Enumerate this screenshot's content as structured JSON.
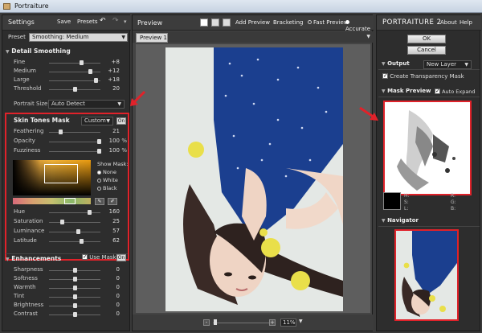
{
  "window": {
    "title": "Portraiture"
  },
  "left": {
    "settings_label": "Settings",
    "save_label": "Save",
    "presets_label": "Presets",
    "preset_label": "Preset",
    "preset_value": "Smoothing: Medium",
    "detail_smoothing_title": "Detail Smoothing",
    "detail_rows": [
      {
        "label": "Fine",
        "value": "+8",
        "pos": 0.62
      },
      {
        "label": "Medium",
        "value": "+12",
        "pos": 0.8
      },
      {
        "label": "Large",
        "value": "+18",
        "pos": 0.9
      },
      {
        "label": "Threshold",
        "value": "20",
        "pos": 0.5
      }
    ],
    "portrait_size_label": "Portrait Size",
    "portrait_size_value": "Auto Detect",
    "skin_title": "Skin Tones Mask",
    "skin_mode": "Custom",
    "on_label": "On",
    "skin_rows": [
      {
        "label": "Feathering",
        "value": "21",
        "unit": "",
        "pos": 0.22
      },
      {
        "label": "Opacity",
        "value": "100",
        "unit": "%",
        "pos": 0.97
      },
      {
        "label": "Fuzziness",
        "value": "100",
        "unit": "%",
        "pos": 0.97
      }
    ],
    "show_mask_label": "Show Mask:",
    "show_mask_options": [
      "None",
      "White",
      "Black"
    ],
    "hsl_rows": [
      {
        "label": "Hue",
        "value": "160",
        "pos": 0.78
      },
      {
        "label": "Saturation",
        "value": "25",
        "pos": 0.25
      },
      {
        "label": "Luminance",
        "value": "57",
        "pos": 0.57
      },
      {
        "label": "Latitude",
        "value": "62",
        "pos": 0.62
      }
    ],
    "enhancements_title": "Enhancements",
    "use_mask_label": "Use Mask",
    "enh_rows": [
      {
        "label": "Sharpness",
        "value": "0"
      },
      {
        "label": "Softness",
        "value": "0"
      },
      {
        "label": "Warmth",
        "value": "0"
      },
      {
        "label": "Tint",
        "value": "0"
      },
      {
        "label": "Brightness",
        "value": "0"
      },
      {
        "label": "Contrast",
        "value": "0"
      }
    ]
  },
  "center": {
    "preview_label": "Preview",
    "add_preview_label": "Add Preview",
    "bracketing_label": "Bracketing",
    "fast_preview_label": "Fast Preview",
    "accurate_label": "Accurate",
    "tab_label": "Preview 1",
    "zoom_value": "11%"
  },
  "right": {
    "logo_text": "PORTRAITURE 2",
    "about_label": "About",
    "help_label": "Help",
    "ok_label": "OK",
    "cancel_label": "Cancel",
    "output_title": "Output",
    "output_value": "New Layer",
    "create_mask_label": "Create Transparency Mask",
    "mask_preview_title": "Mask Preview",
    "auto_expand_label": "Auto Expand",
    "color_labels": [
      "H:",
      "S:",
      "L:",
      "R:",
      "G:",
      "B:"
    ],
    "navigator_title": "Navigator"
  },
  "colors": {
    "accent_red": "#e0222a",
    "panel": "#2d2d2d"
  }
}
